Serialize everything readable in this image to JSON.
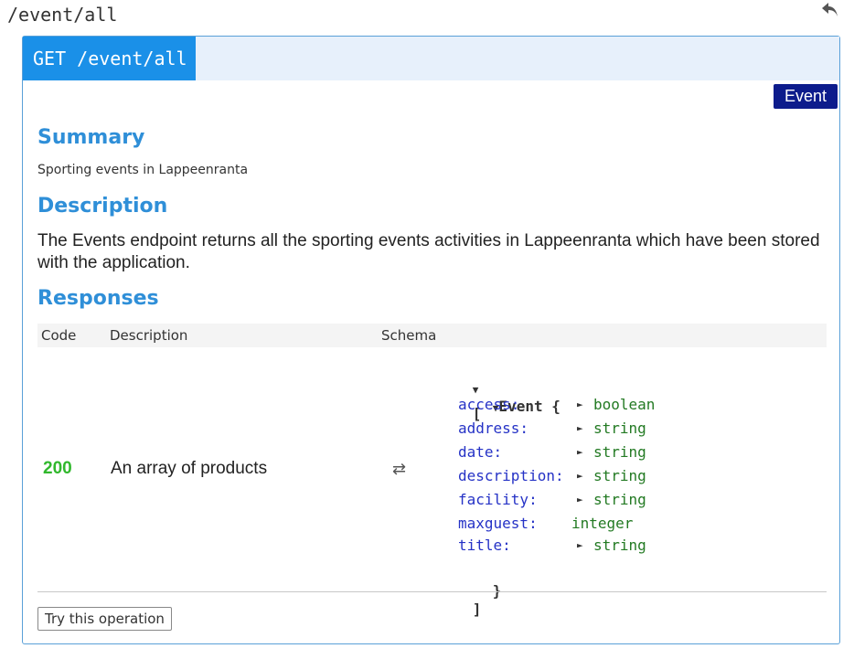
{
  "page": {
    "path_title": "/event/all"
  },
  "operation": {
    "method_path": "GET /event/all",
    "tag": "Event",
    "summary_heading": "Summary",
    "summary": "Sporting events in Lappeenranta",
    "description_heading": "Description",
    "description": "The Events endpoint returns all the sporting events activities in Lappeenranta which have been stored with the application.",
    "responses_heading": "Responses"
  },
  "responses_table": {
    "headers": {
      "code": "Code",
      "description": "Description",
      "schema": "Schema"
    },
    "row": {
      "code": "200",
      "description": "An array of products",
      "swap_symbol": "⇄"
    }
  },
  "schema": {
    "toggle_expanded": "▼",
    "toggle_collapsed": "►",
    "open_array": "[",
    "close_array": "]",
    "model_name": "Event",
    "open_brace": "{",
    "close_brace": "}",
    "properties": [
      {
        "name": "access:",
        "type": "boolean",
        "expandable": true
      },
      {
        "name": "address:",
        "type": "string",
        "expandable": true
      },
      {
        "name": "date:",
        "type": "string",
        "expandable": true
      },
      {
        "name": "description:",
        "type": "string",
        "expandable": true
      },
      {
        "name": "facility:",
        "type": "string",
        "expandable": true
      },
      {
        "name": "maxguest:",
        "type": "integer",
        "expandable": false
      },
      {
        "name": "title:",
        "type": "string",
        "expandable": true
      }
    ]
  },
  "actions": {
    "try_label": "Try this operation"
  },
  "icons": {
    "back": "back-arrow-icon",
    "swap": "swap-icon"
  },
  "colors": {
    "method_bg": "#1a90e8",
    "tag_bg": "#0d1c8c",
    "heading": "#2f8fd8",
    "code_ok": "#31b82d",
    "prop_name": "#2532c6",
    "prop_type": "#237a23"
  }
}
